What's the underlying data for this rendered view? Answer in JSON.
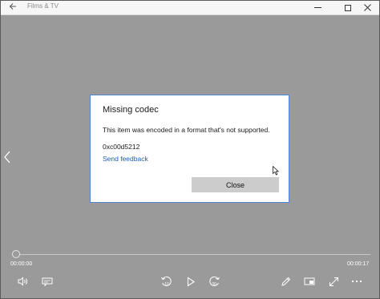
{
  "window": {
    "app_title": "Films & TV"
  },
  "dialog": {
    "title": "Missing codec",
    "message": "This item was encoded in a format that's not supported.",
    "error_code": "0xc00d5212",
    "feedback_link": "Send feedback",
    "close_button": "Close"
  },
  "player": {
    "current_time": "00:00:00",
    "total_time": "00:00:17",
    "progress": 0,
    "skip_back_seconds": "10",
    "skip_forward_seconds": "30"
  },
  "icons": {
    "back": "back-arrow-icon",
    "minimize": "minimize-icon",
    "maximize": "maximize-icon",
    "close": "close-icon",
    "previous": "chevron-left-icon",
    "volume": "volume-icon",
    "subtitles": "subtitles-icon",
    "skip_back": "skip-back-icon",
    "play": "play-icon",
    "skip_forward": "skip-forward-icon",
    "edit": "pencil-icon",
    "mini_view": "mini-view-icon",
    "fullscreen": "fullscreen-icon",
    "more": "more-icon"
  },
  "colors": {
    "background": "#9a9a9a",
    "dialog_border": "#4f86d6",
    "link": "#1e5fb4",
    "button": "#cccccc"
  }
}
